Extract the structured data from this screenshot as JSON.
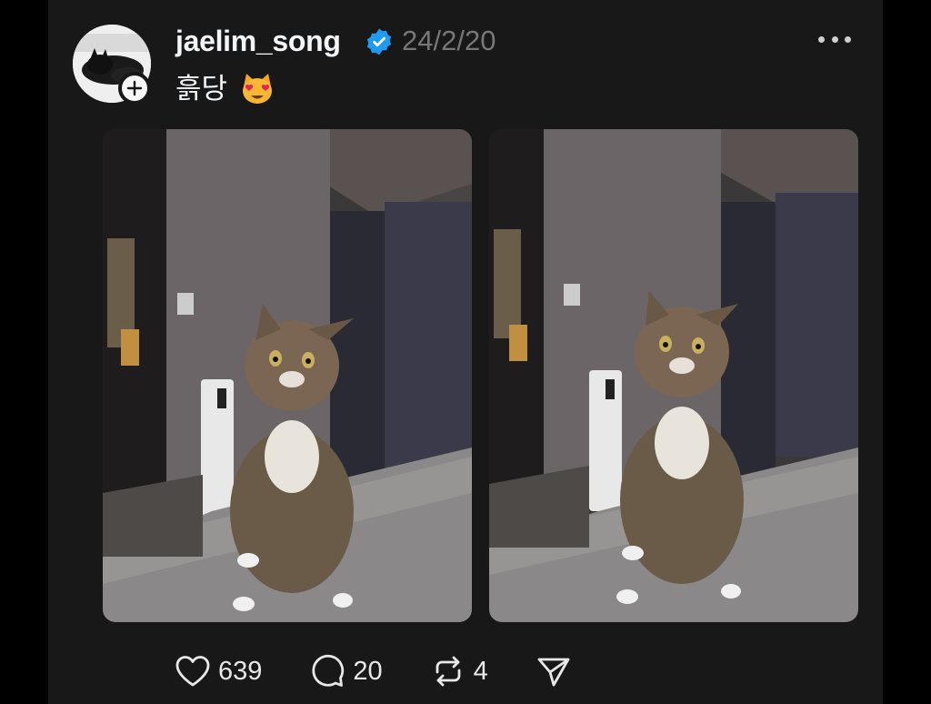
{
  "post": {
    "username": "jaelim_song",
    "timestamp": "24/2/20",
    "caption": "흙당",
    "caption_emoji": "😻",
    "verified": true
  },
  "images": [
    {
      "alt": "tabby cat sitting on bed, photo 1"
    },
    {
      "alt": "tabby cat sitting on bed, photo 2"
    }
  ],
  "actions": {
    "likes": "639",
    "replies": "20",
    "reposts": "4"
  },
  "icons": {
    "verified": "verified-badge-icon",
    "more": "more-dots-icon",
    "like": "heart-icon",
    "reply": "speech-bubble-icon",
    "repost": "repost-icon",
    "share": "send-icon",
    "follow": "plus-icon"
  },
  "colors": {
    "background": "#181818",
    "accent_verified": "#1d9bf0",
    "muted": "#777777"
  }
}
